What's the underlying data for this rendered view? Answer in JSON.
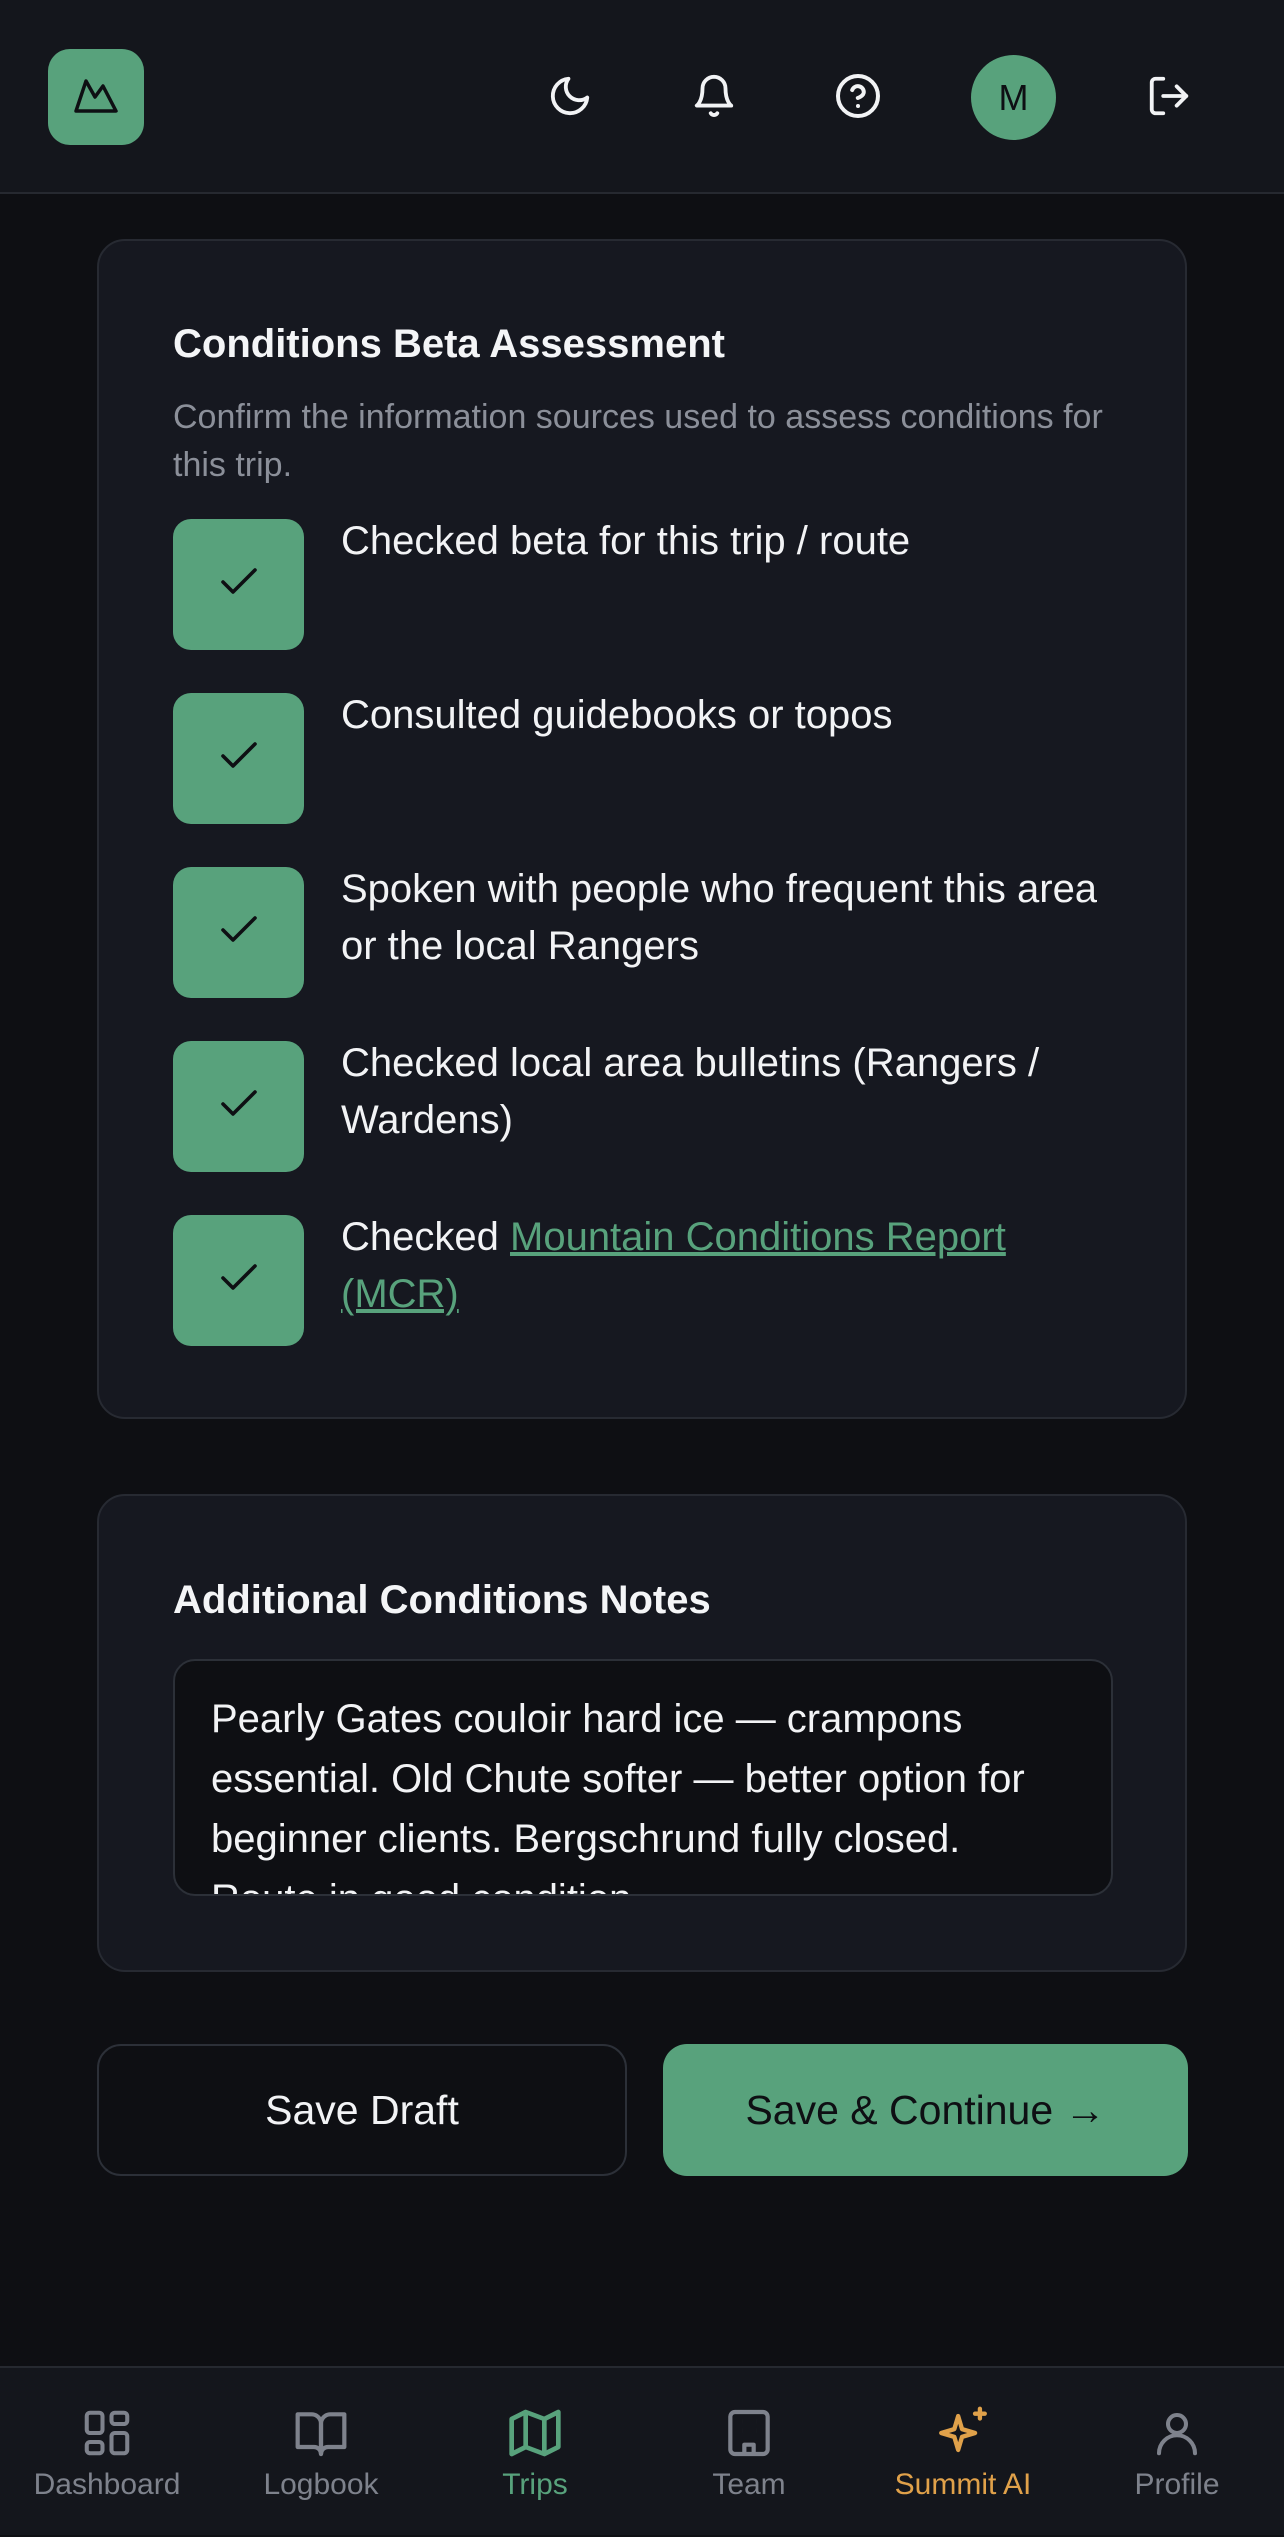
{
  "header": {
    "logo_icon": "mountain-icon",
    "icons": [
      "moon-icon",
      "bell-icon",
      "help-icon",
      "logout-icon"
    ],
    "avatar_initial": "M"
  },
  "beta_card": {
    "title": "Conditions Beta Assessment",
    "subtitle": "Confirm the information sources used to assess conditions for this trip.",
    "items": [
      {
        "label": "Checked beta for this trip / route",
        "checked": true
      },
      {
        "label": "Consulted guidebooks or topos",
        "checked": true
      },
      {
        "label": "Spoken with people who frequent this area or the local Rangers",
        "checked": true
      },
      {
        "label": "Checked local area bulletins (Rangers / Wardens)",
        "checked": true
      },
      {
        "label_prefix": "Checked",
        "link_text": "Mountain Conditions Report (MCR)",
        "checked": true
      }
    ]
  },
  "notes_card": {
    "title": "Additional Conditions Notes",
    "value": "Pearly Gates couloir hard ice — crampons essential. Old Chute softer — better option for beginner clients. Bergschrund fully closed. Route in good condition."
  },
  "actions": {
    "save_draft": "Save Draft",
    "save_continue": "Save & Continue →"
  },
  "nav": [
    {
      "label": "Dashboard",
      "icon": "grid-icon",
      "color": "#7e828c"
    },
    {
      "label": "Logbook",
      "icon": "book-icon",
      "color": "#7e828c"
    },
    {
      "label": "Trips",
      "icon": "map-icon",
      "color": "#58a27c",
      "active": true
    },
    {
      "label": "Team",
      "icon": "building-icon",
      "color": "#7e828c"
    },
    {
      "label": "Summit AI",
      "icon": "sparkles-icon",
      "color": "#e0a14a"
    },
    {
      "label": "Profile",
      "icon": "user-icon",
      "color": "#7e828c"
    }
  ],
  "colors": {
    "accent": "#58a27c",
    "ai": "#e0a14a",
    "background": "#0e0f13",
    "card": "#161820"
  }
}
